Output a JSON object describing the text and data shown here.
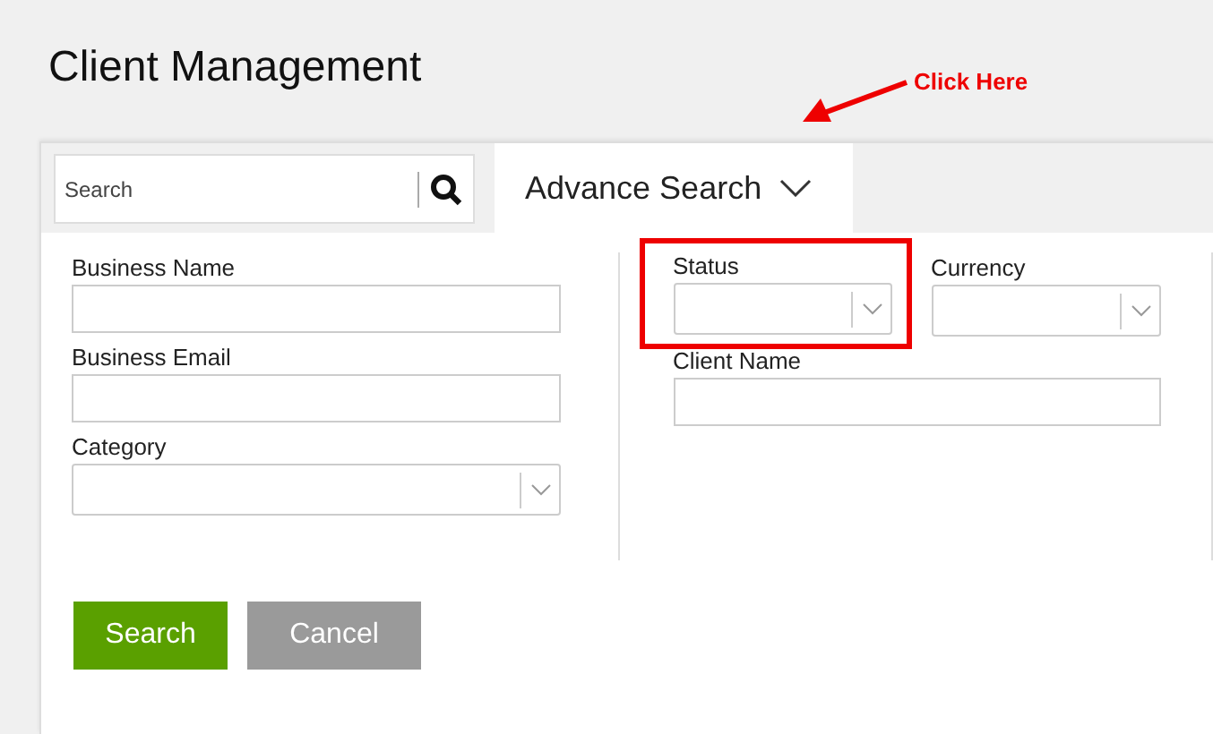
{
  "page_title": "Client Management",
  "annotation": {
    "text": "Click Here"
  },
  "search": {
    "placeholder": "Search"
  },
  "tab": {
    "label": "Advance Search",
    "expanded": true
  },
  "columns": [
    {
      "rows": [
        {
          "fields": [
            {
              "label": "Business Name",
              "kind": "text",
              "highlighted": false
            }
          ]
        },
        {
          "fields": [
            {
              "label": "Business Email",
              "kind": "text",
              "highlighted": false
            }
          ]
        },
        {
          "fields": [
            {
              "label": "Category",
              "kind": "select",
              "highlighted": false
            }
          ]
        }
      ]
    },
    {
      "rows": [
        {
          "fields": [
            {
              "label": "Status",
              "kind": "select",
              "highlighted": true
            },
            {
              "label": "Currency",
              "kind": "select",
              "highlighted": false
            }
          ]
        },
        {
          "fields": [
            {
              "label": "Client Name",
              "kind": "text",
              "highlighted": false
            }
          ]
        }
      ]
    }
  ],
  "buttons": [
    {
      "label": "Search",
      "kind": "primary"
    },
    {
      "label": "Cancel",
      "kind": "secondary"
    }
  ]
}
